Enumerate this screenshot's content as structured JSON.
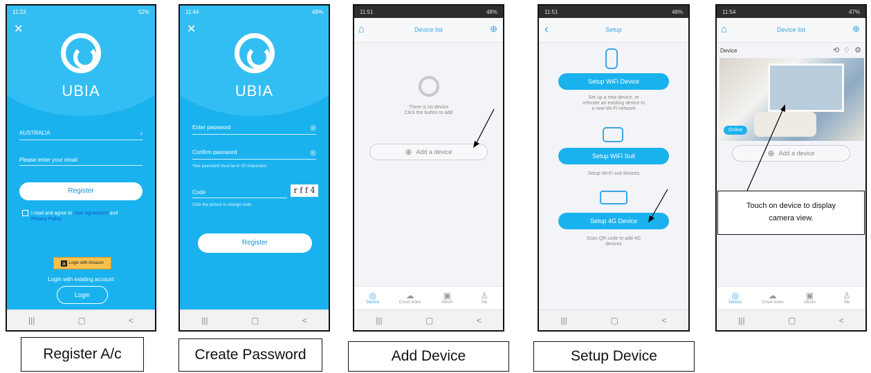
{
  "screens": {
    "register": {
      "status_time": "11:23",
      "status_right": "52%",
      "close_icon": "close-icon",
      "brand": "UBIA",
      "country": "AUSTRALIA",
      "email_placeholder": "Please enter your email",
      "register_label": "Register",
      "agree_prefix": "I read and agree to",
      "user_agreement": "User Agreement",
      "and": "and",
      "privacy_policy": "Privacy Policy",
      "amazon_label": "Login with Amazon",
      "existing_account": "Login with existing account",
      "login_label": "Login"
    },
    "password": {
      "status_time": "11:44",
      "status_right": "49%",
      "brand": "UBIA",
      "enter_password": "Enter password",
      "confirm_password": "Confirm password",
      "password_hint": "Your password must be 6~32 characters",
      "code_label": "Code",
      "captcha": "r f f 4",
      "code_hint": "Click the picture to change code",
      "register_label": "Register"
    },
    "device_list_empty": {
      "status_time": "11:51",
      "status_right": "48%",
      "title": "Device list",
      "empty_line1": "There is no device",
      "empty_line2": "Click the button to add",
      "add_device": "Add a device",
      "tabs": [
        "Device",
        "Cloud video",
        "Album",
        "Me"
      ]
    },
    "setup": {
      "status_time": "11:51",
      "status_right": "48%",
      "title": "Setup",
      "wifi_device": "Setup WiFi Device",
      "wifi_device_desc": [
        "Set up a new device, or",
        "relocate an existing device to",
        "a new Wi-Fi network"
      ],
      "wifi_suit": "Setup WiFi Suit",
      "wifi_suit_desc": "Setup Wi-Fi suit devices",
      "device_4g": "Setup 4G Device",
      "device_4g_desc": [
        "Scan QR code to add 4G",
        "devices"
      ]
    },
    "device_list_camera": {
      "status_time": "11:54",
      "status_right": "47%",
      "title": "Device list",
      "device_label": "Device",
      "online": "Online",
      "add_device": "Add a device",
      "tooltip_line1": "Touch on device to display",
      "tooltip_line2": "camera view.",
      "tabs": [
        "Device",
        "Cloud video",
        "Album",
        "Me"
      ]
    }
  },
  "captions": {
    "register": "Register A/c",
    "password": "Create Password",
    "add_device": "Add Device",
    "setup_device": "Setup Device"
  },
  "nav_glyphs": [
    "|||",
    "▢",
    "<"
  ],
  "colors": {
    "brand_blue": "#1ab2ee",
    "accent": "#3aa6e6"
  }
}
